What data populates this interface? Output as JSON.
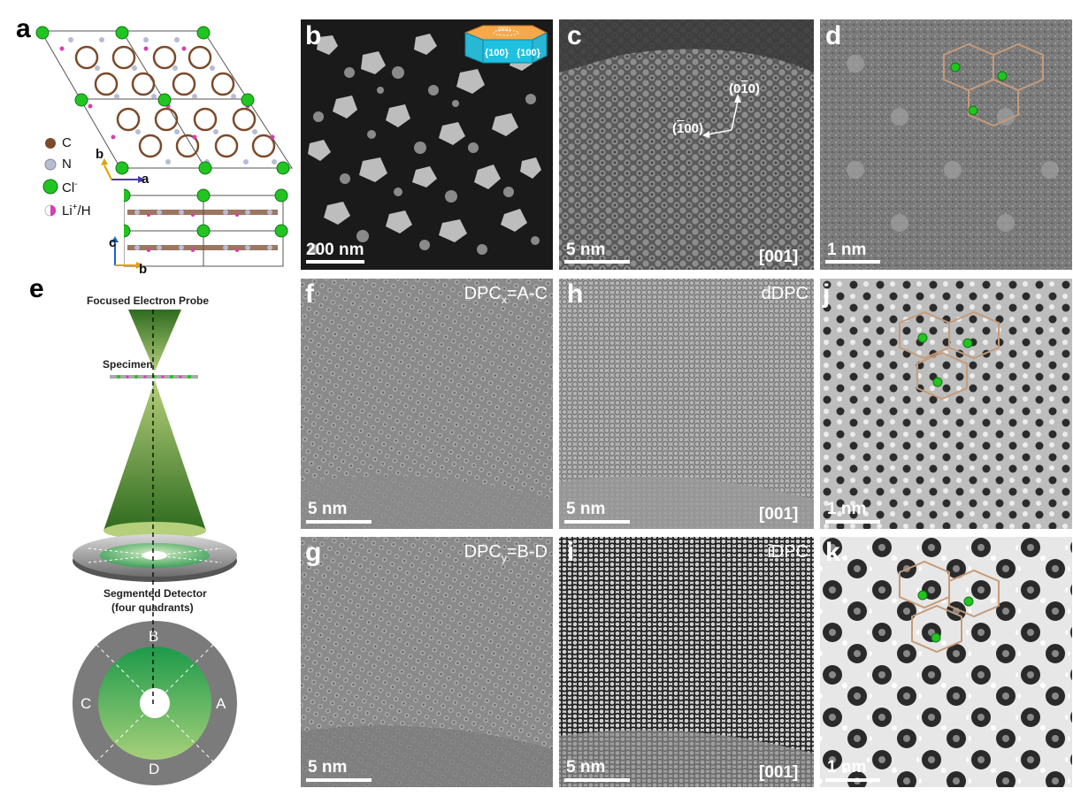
{
  "panel_letters": {
    "a": "a",
    "b": "b",
    "c": "c",
    "d": "d",
    "e": "e",
    "f": "f",
    "g": "g",
    "h": "h",
    "i": "i",
    "j": "j",
    "k": "k"
  },
  "legend": {
    "c": "C",
    "n": "N",
    "cl": "Cl",
    "cl_sup": "-",
    "li": "Li",
    "li_sup": "+",
    "li_tail": "/H"
  },
  "axes": {
    "a": "a",
    "b": "b",
    "c": "c",
    "b2": "b"
  },
  "scalebars": {
    "b": "200 nm",
    "c": "5 nm",
    "d": "1 nm",
    "f": "5 nm",
    "h": "5 nm",
    "j": "1 nm",
    "g": "5 nm",
    "i": "5 nm",
    "k": "1 nm"
  },
  "zone_axis": {
    "c": "[001]",
    "h": "[001]",
    "i": "[001]"
  },
  "facets": {
    "left": "{100}",
    "right": "{100}",
    "top": "(001)"
  },
  "directions": {
    "d1": "(0",
    "d1_bar": "1",
    "d1_end": "0)",
    "d2": "(",
    "d2_bar": "1",
    "d2_end": "00)"
  },
  "names": {
    "f": "DPC",
    "f_sub": "x",
    "f_tail": "=A-C",
    "g": "DPC",
    "g_sub": "y",
    "g_tail": "=B-D",
    "h": "dDPC",
    "i": "iDPC"
  },
  "diagram": {
    "probe": "Focused Electron Probe",
    "specimen": "Specimen",
    "detector_line1": "Segmented Detector",
    "detector_line2": "(four quadrants)",
    "quadrants": {
      "a": "A",
      "b": "B",
      "c": "C",
      "d": "D"
    }
  }
}
